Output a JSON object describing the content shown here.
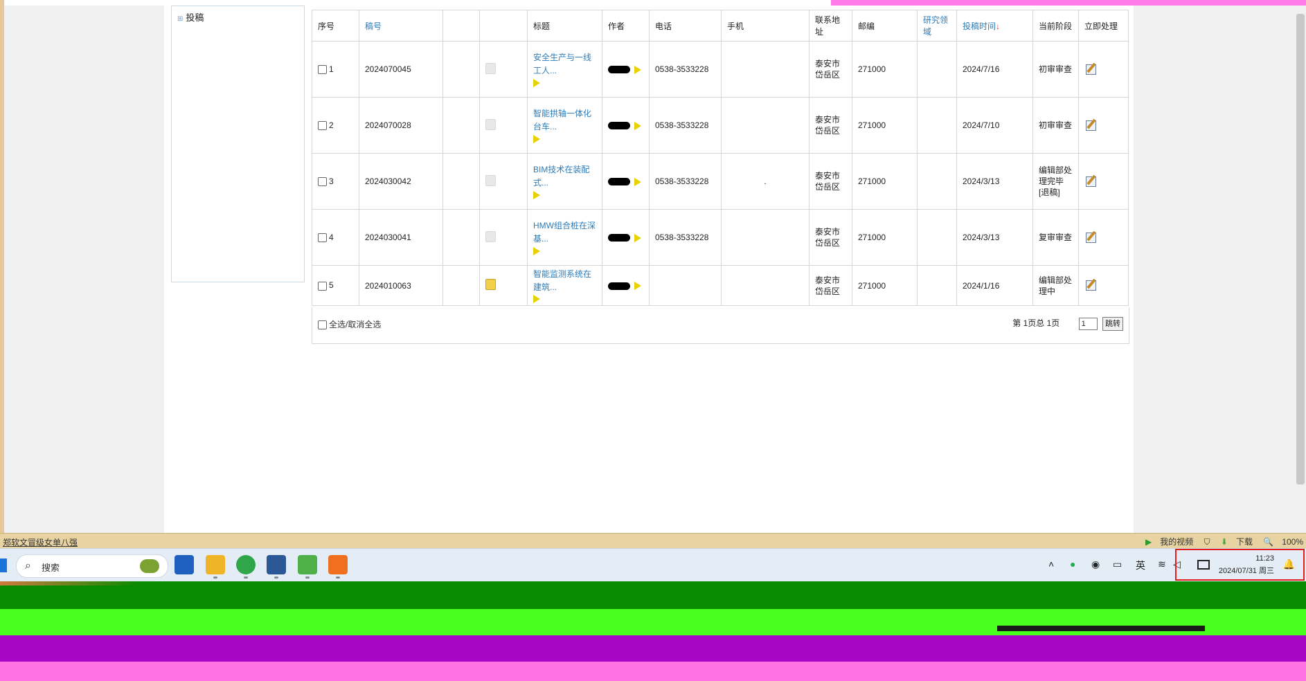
{
  "tree": {
    "item_label": "投稿"
  },
  "table": {
    "headers": [
      "序号",
      "稿号",
      "",
      "",
      "标题",
      "作者",
      "电话",
      "手机",
      "联系地址",
      "邮编",
      "研究领域",
      "投稿时间",
      "当前阶段",
      "立即处理"
    ],
    "sort_arrow": "↓",
    "rows": [
      {
        "num": "1",
        "id": "2024070045",
        "title": "安全生产与一线工人...",
        "phone": "0538-3533228",
        "mobile": "",
        "address": "泰安市岱岳区",
        "zip": "271000",
        "date": "2024/7/16",
        "stage": "初审审查",
        "note_color": "gray"
      },
      {
        "num": "2",
        "id": "2024070028",
        "title": "智能拱轴一体化台车...",
        "phone": "0538-3533228",
        "mobile": "",
        "address": "泰安市岱岳区",
        "zip": "271000",
        "date": "2024/7/10",
        "stage": "初审审查",
        "note_color": "gray"
      },
      {
        "num": "3",
        "id": "2024030042",
        "title": "BIM技术在装配式...",
        "phone": "0538-3533228",
        "mobile": ".",
        "address": "泰安市岱岳区",
        "zip": "271000",
        "date": "2024/3/13",
        "stage": "编辑部处理完毕[退稿]",
        "note_color": "gray"
      },
      {
        "num": "4",
        "id": "2024030041",
        "title": "HMW组合桩在深基...",
        "phone": "0538-3533228",
        "mobile": "",
        "address": "泰安市岱岳区",
        "zip": "271000",
        "date": "2024/3/13",
        "stage": "复审审查",
        "note_color": "gray"
      },
      {
        "num": "5",
        "id": "2024010063",
        "title": "智能监测系统在建筑...",
        "phone": "",
        "mobile": "",
        "address": "泰安市岱岳区",
        "zip": "271000",
        "date": "2024/1/16",
        "stage": "编辑部处理中",
        "note_color": "yellow"
      }
    ]
  },
  "footer": {
    "select_all": "全选/取消全选",
    "page_info": "第 1页总 1页",
    "page_value": "1",
    "jump_label": "跳转"
  },
  "status_bar": {
    "left_text": "郑软文冒级女单八强",
    "video": "我的视频",
    "download": "下载",
    "zoom": "100%"
  },
  "taskbar": {
    "search_placeholder": "搜索",
    "ime": "英",
    "time": "11:23",
    "date": "2024/07/31 周三"
  },
  "colors": {
    "link": "#2b7bb9",
    "status_bar": "#e8d4a2",
    "highlight": "#e01c1c"
  }
}
